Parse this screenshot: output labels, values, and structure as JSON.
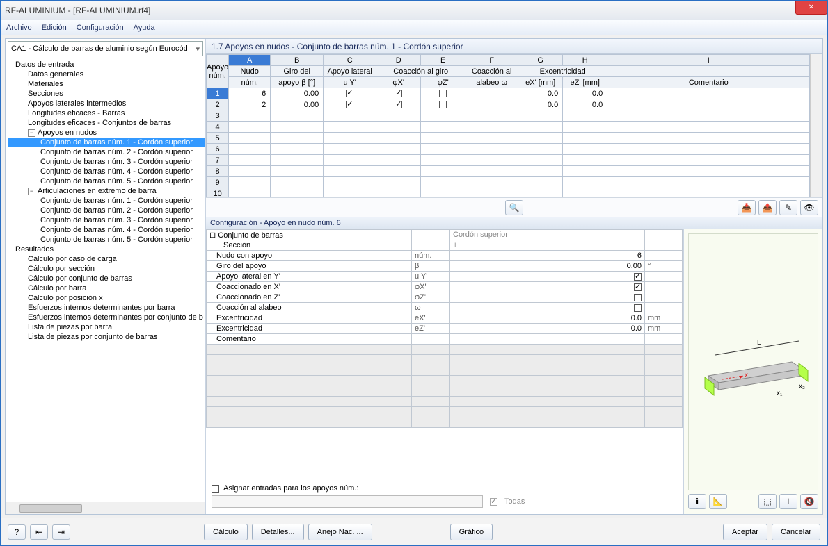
{
  "window": {
    "title": "RF-ALUMINIUM - [RF-ALUMINIUM.rf4]"
  },
  "menu": {
    "archivo": "Archivo",
    "edicion": "Edición",
    "configuracion": "Configuración",
    "ayuda": "Ayuda"
  },
  "combo": {
    "value": "CA1 - Cálculo de barras de aluminio según Eurocód"
  },
  "tree": {
    "datos": "Datos de entrada",
    "datos_generales": "Datos generales",
    "materiales": "Materiales",
    "secciones": "Secciones",
    "apoyos_laterales": "Apoyos laterales intermedios",
    "long_barras": "Longitudes eficaces - Barras",
    "long_conj": "Longitudes eficaces - Conjuntos de barras",
    "apoyos_nudos": "Apoyos en nudos",
    "conj1": "Conjunto de barras núm. 1 - Cordón superior",
    "conj2": "Conjunto de barras núm. 2 - Cordón superior",
    "conj3": "Conjunto de barras núm. 3 - Cordón superior",
    "conj4": "Conjunto de barras núm. 4 - Cordón superior",
    "conj5": "Conjunto de barras núm. 5 - Cordón superior",
    "artic": "Articulaciones en extremo de barra",
    "aconj1": "Conjunto de barras núm. 1 - Cordón superior",
    "aconj2": "Conjunto de barras núm. 2 - Cordón superior",
    "aconj3": "Conjunto de barras núm. 3 - Cordón superior",
    "aconj4": "Conjunto de barras núm. 4 - Cordón superior",
    "aconj5": "Conjunto de barras núm. 5 - Cordón superior",
    "resultados": "Resultados",
    "r1": "Cálculo por caso de carga",
    "r2": "Cálculo por sección",
    "r3": "Cálculo por conjunto de barras",
    "r4": "Cálculo por barra",
    "r5": "Cálculo por posición x",
    "r6": "Esfuerzos internos determinantes por barra",
    "r7": "Esfuerzos internos determinantes por conjunto de b",
    "r8": "Lista de piezas por barra",
    "r9": "Lista de piezas por conjunto de barras"
  },
  "main_title": "1.7 Apoyos en nudos - Conjunto de barras núm. 1 - Cordón superior",
  "grid": {
    "cols": [
      "A",
      "B",
      "C",
      "D",
      "E",
      "F",
      "G",
      "H",
      "I"
    ],
    "rowhdr": {
      "l1": "Apoyo",
      "l2": "núm."
    },
    "h": {
      "A1": "Nudo",
      "A2": "núm.",
      "B1": "Giro del",
      "B2": "apoyo β [°]",
      "C1": "Apoyo lateral",
      "C2": "u Y'",
      "DE1": "Coacción al giro",
      "D2": "φX'",
      "E2": "φZ'",
      "F1": "Coacción al",
      "F2": "alabeo ω",
      "GH1": "Excentricidad",
      "G2": "eX' [mm]",
      "H2": "eZ' [mm]",
      "I1": "",
      "I2": "Comentario"
    },
    "rows": [
      {
        "n": "1",
        "A": "6",
        "B": "0.00",
        "C": true,
        "D": true,
        "E": false,
        "F": false,
        "G": "0.0",
        "H": "0.0",
        "I": ""
      },
      {
        "n": "2",
        "A": "2",
        "B": "0.00",
        "C": true,
        "D": true,
        "E": false,
        "F": false,
        "G": "0.0",
        "H": "0.0",
        "I": ""
      },
      {
        "n": "3"
      },
      {
        "n": "4"
      },
      {
        "n": "5"
      },
      {
        "n": "6"
      },
      {
        "n": "7"
      },
      {
        "n": "8"
      },
      {
        "n": "9"
      },
      {
        "n": "10"
      }
    ]
  },
  "config": {
    "title": "Configuración - Apoyo en nudo núm. 6",
    "rows": {
      "conj_k": "Conjunto de barras",
      "conj_v": "Cordón superior",
      "secc_k": "Sección",
      "secc_v": "+",
      "nudo_k": "Nudo con apoyo",
      "nudo_s": "núm.",
      "nudo_v": "6",
      "giro_k": "Giro del apoyo",
      "giro_s": "β",
      "giro_v": "0.00",
      "giro_u": "°",
      "apy_k": "Apoyo lateral en Y'",
      "apy_s": "u Y'",
      "apy_v": true,
      "cox_k": "Coaccionado en X'",
      "cox_s": "φX'",
      "cox_v": true,
      "coz_k": "Coaccionado en Z'",
      "coz_s": "φZ'",
      "coz_v": false,
      "coa_k": "Coacción al alabeo",
      "coa_s": "ω",
      "coa_v": false,
      "ex1_k": "Excentricidad",
      "ex1_s": "eX'",
      "ex1_v": "0.0",
      "ex1_u": "mm",
      "ex2_k": "Excentricidad",
      "ex2_s": "eZ'",
      "ex2_v": "0.0",
      "ex2_u": "mm",
      "com_k": "Comentario"
    }
  },
  "assign": {
    "label": "Asignar entradas para los apoyos núm.:",
    "todas": "Todas"
  },
  "footer": {
    "calculo": "Cálculo",
    "detalles": "Detalles...",
    "anejo": "Anejo Nac. ...",
    "grafico": "Gráfico",
    "aceptar": "Aceptar",
    "cancelar": "Cancelar"
  },
  "icons": {
    "magnifier": "🔍",
    "excel_in": "📥",
    "excel_out": "📤",
    "pick": "✎",
    "eye": "👁",
    "info": "ℹ",
    "tool1": "📐",
    "tool2": "⬚",
    "tool3": "⊥",
    "tool4": "🔇",
    "help": "?",
    "nav1": "⇤",
    "nav2": "⇥"
  },
  "preview_labels": {
    "L": "L",
    "x": "x",
    "x1": "x₁",
    "x2": "x₂"
  }
}
